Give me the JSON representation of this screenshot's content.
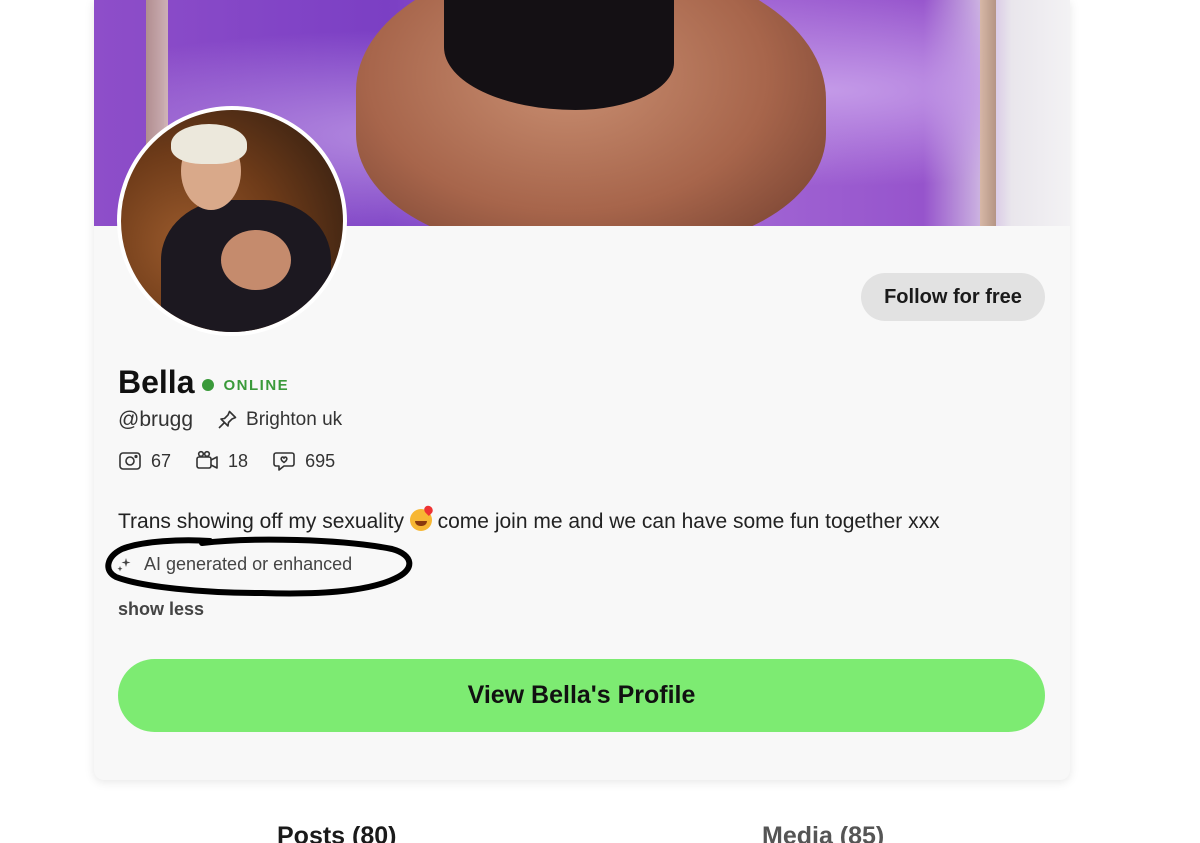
{
  "profile": {
    "name": "Bella",
    "status": "ONLINE",
    "handle": "@brugg",
    "location": "Brighton uk",
    "stats": {
      "photos": "67",
      "videos": "18",
      "likes": "695"
    },
    "bio_before_emoji": "Trans showing off my sexuality ",
    "bio_after_emoji": " come join me and we can have some fun together xxx",
    "ai_label": "AI generated or enhanced",
    "show_less": "show less"
  },
  "buttons": {
    "follow": "Follow for free",
    "view_profile": "View Bella's Profile"
  },
  "tabs": [
    {
      "label": "Posts (80)"
    },
    {
      "label": "Media (85)"
    }
  ],
  "icons": {
    "pin": "pin-icon",
    "photos": "camera-icon",
    "videos": "video-icon",
    "likes": "chat-heart-icon",
    "ai": "sparkle-icon",
    "emoji": "smiling-face-with-hearts"
  },
  "colors": {
    "online": "#3a9a3a",
    "view_button": "#7deb72",
    "follow_button": "#e2e2e2",
    "card_background": "#f8f8f8"
  }
}
